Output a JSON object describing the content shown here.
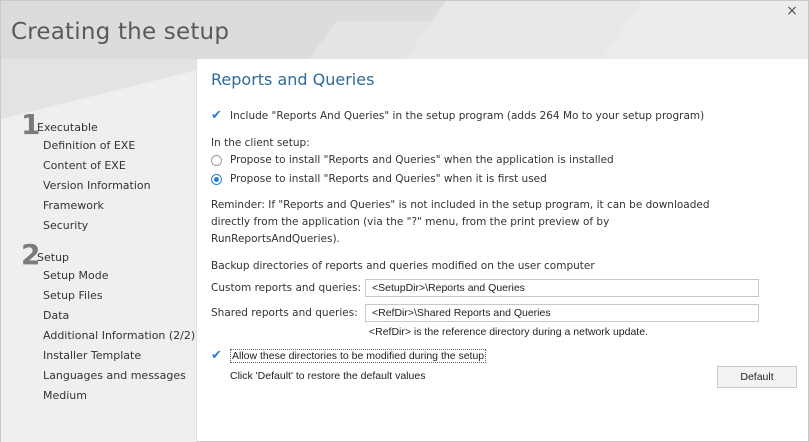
{
  "window": {
    "title": "Creating the setup",
    "close_glyph": "×"
  },
  "sidebar": {
    "step1": {
      "number": "1",
      "label": "Executable"
    },
    "step1_items": [
      "Definition of EXE",
      "Content of EXE",
      "Version Information",
      "Framework",
      "Security"
    ],
    "step2": {
      "number": "2",
      "label": "Setup"
    },
    "step2_items": [
      "Setup Mode",
      "Setup Files",
      "Data",
      "Additional Information (2/2)",
      "Installer Template",
      "Languages and messages",
      "Medium"
    ]
  },
  "main": {
    "title": "Reports and Queries",
    "include_checkbox": {
      "checked": true,
      "label": "Include \"Reports And Queries\" in the setup program (adds 264 Mo to your setup program)"
    },
    "client_setup_label": "In the client setup:",
    "radio_options": [
      {
        "label": "Propose to install \"Reports and Queries\" when the application is installed",
        "selected": false
      },
      {
        "label": "Propose to install \"Reports and Queries\" when it is first used",
        "selected": true
      }
    ],
    "reminder_lines": [
      "Reminder: If \"Reports and Queries\" is not included in the setup program, it can be downloaded",
      "directly from the application (via the \"?\" menu, from the print preview of by",
      "RunReportsAndQueries)."
    ],
    "backup_label": "Backup directories of reports and queries modified on the user computer",
    "custom_label": "Custom reports and queries:",
    "custom_value": "<SetupDir>\\Reports and Queries",
    "shared_label": "Shared reports and queries:",
    "shared_value": "<RefDir>\\Shared Reports and Queries",
    "refdir_note": "<RefDir> is the reference directory during a network update.",
    "allow_checkbox": {
      "checked": true,
      "label": "Allow these directories to be modified during the setup"
    },
    "default_hint": "Click 'Default' to restore the default values",
    "default_button": "Default"
  },
  "colors": {
    "accent": "#2a7fd4",
    "title_blue": "#2e6a9e",
    "header_bg": "#dcdcdc",
    "sidebar_bg": "#efefef"
  }
}
